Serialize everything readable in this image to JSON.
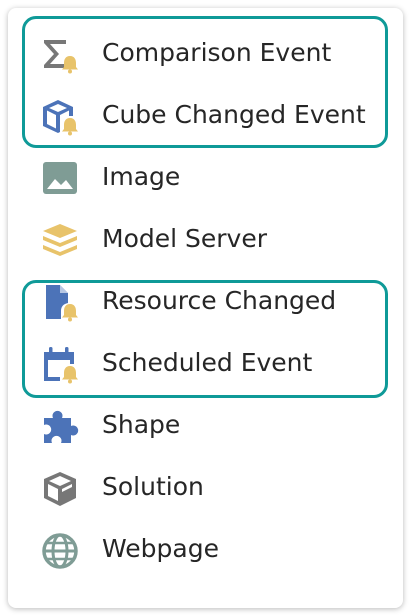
{
  "colors": {
    "highlight_outline": "#0f9a98",
    "icon_blue": "#4c73b8",
    "icon_gold": "#e8c36a",
    "icon_gray_green": "#7f9c95",
    "icon_gray": "#777777"
  },
  "menu": {
    "items": [
      {
        "label": "Comparison Event",
        "icon": "sigma-bell-icon"
      },
      {
        "label": "Cube Changed Event",
        "icon": "cube-bell-icon"
      },
      {
        "label": "Image",
        "icon": "image-icon"
      },
      {
        "label": "Model Server",
        "icon": "server-stack-icon"
      },
      {
        "label": "Resource Changed",
        "icon": "file-bell-icon"
      },
      {
        "label": "Scheduled Event",
        "icon": "calendar-bell-icon"
      },
      {
        "label": "Shape",
        "icon": "puzzle-icon"
      },
      {
        "label": "Solution",
        "icon": "box-icon"
      },
      {
        "label": "Webpage",
        "icon": "globe-icon"
      }
    ]
  }
}
